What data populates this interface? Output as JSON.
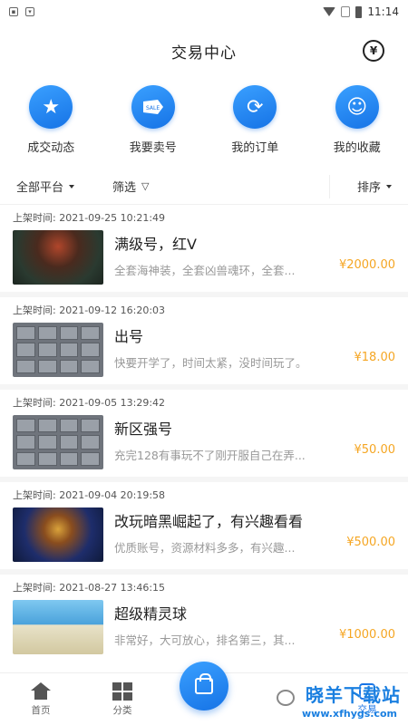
{
  "status_bar": {
    "time": "11:14"
  },
  "header": {
    "title": "交易中心",
    "coin_icon": "yuan-coin-icon"
  },
  "quick_actions": [
    {
      "label": "成交动态",
      "icon": "star-icon"
    },
    {
      "label": "我要卖号",
      "icon": "sale-tag-icon"
    },
    {
      "label": "我的订单",
      "icon": "refresh-arrows-icon"
    },
    {
      "label": "我的收藏",
      "icon": "smile-icon"
    }
  ],
  "filters": {
    "platform": "全部平台",
    "filter": "筛选",
    "sort": "排序"
  },
  "listings": [
    {
      "time": "上架时间: 2021-09-25 10:21:49",
      "title": "满级号，红V",
      "desc": "全套海神装，全套凶兽魂环，全套...",
      "price": "¥2000.00"
    },
    {
      "time": "上架时间: 2021-09-12 16:20:03",
      "title": "出号",
      "desc": "快要开学了，时间太紧，没时间玩了。",
      "price": "¥18.00"
    },
    {
      "time": "上架时间: 2021-09-05 13:29:42",
      "title": "新区强号",
      "desc": "充完128有事玩不了刚开服自己在弄...",
      "price": "¥50.00"
    },
    {
      "time": "上架时间: 2021-09-04 20:19:58",
      "title": "改玩暗黑崛起了，有兴趣看看",
      "desc": "优质账号，资源材料多多，有兴趣...",
      "price": "¥500.00"
    },
    {
      "time": "上架时间: 2021-08-27 13:46:15",
      "title": "超级精灵球",
      "desc": "非常好，大可放心，排名第三，其...",
      "price": "¥1000.00"
    }
  ],
  "tabbar": {
    "home": "首页",
    "category": "分类",
    "trade": "交易"
  },
  "watermark": {
    "text": "晓羊下载站",
    "url": "www.xfhygs.com"
  },
  "colors": {
    "accent": "#1673e6",
    "price": "#f5a623"
  }
}
